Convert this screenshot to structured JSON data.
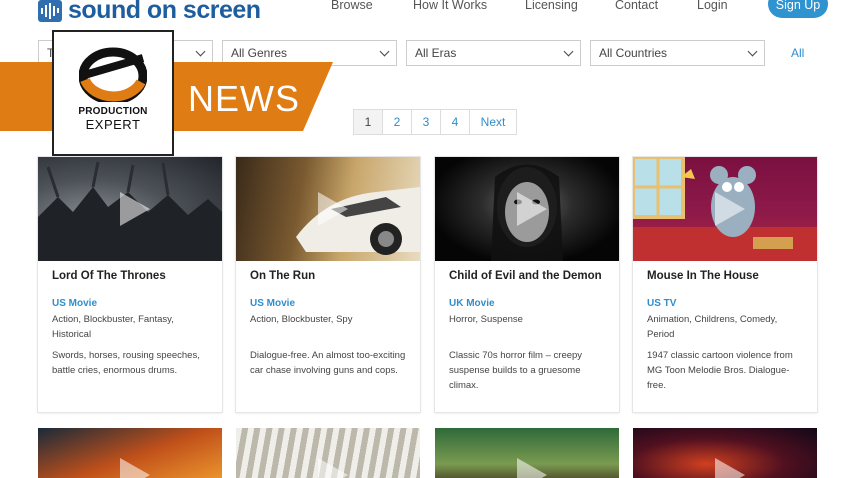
{
  "brand": {
    "name": "sound on screen"
  },
  "nav": {
    "items": [
      "Browse",
      "How It Works",
      "Licensing",
      "Contact",
      "Login"
    ],
    "signup": "Sign Up"
  },
  "filters": {
    "type_value": "T",
    "genre_value": "All Genres",
    "era_value": "All Eras",
    "country_value": "All Countries",
    "all_link": "All"
  },
  "banner": {
    "text": "NEWS",
    "badge_line1": "PRODUCTION",
    "badge_line2": "EXPERT"
  },
  "pagination": {
    "pages": [
      "1",
      "2",
      "3",
      "4"
    ],
    "next": "Next",
    "current": "1"
  },
  "cards": [
    {
      "title": "Lord Of The Thrones",
      "country": "US Movie",
      "genres": "Action, Blockbuster, Fantasy, Historical",
      "description": "Swords, horses, rousing speeches, battle cries, enormous drums."
    },
    {
      "title": "On The Run",
      "country": "US Movie",
      "genres": "Action, Blockbuster, Spy",
      "description": "Dialogue-free. An almost too-exciting car chase involving guns and cops."
    },
    {
      "title": "Child of Evil and the Demon",
      "country": "UK Movie",
      "genres": "Horror, Suspense",
      "description": "Classic 70s horror film – creepy suspense builds to a gruesome climax."
    },
    {
      "title": "Mouse In The House",
      "country": "US TV",
      "genres": "Animation, Childrens, Comedy, Period",
      "description": "1947 classic cartoon violence from MG Toon Melodie Bros. Dialogue-free."
    }
  ],
  "colors": {
    "brand_blue": "#1f5e9e",
    "link_blue": "#2f8ecb",
    "banner_orange": "#e07c14",
    "signup_blue": "#2f93d0"
  }
}
